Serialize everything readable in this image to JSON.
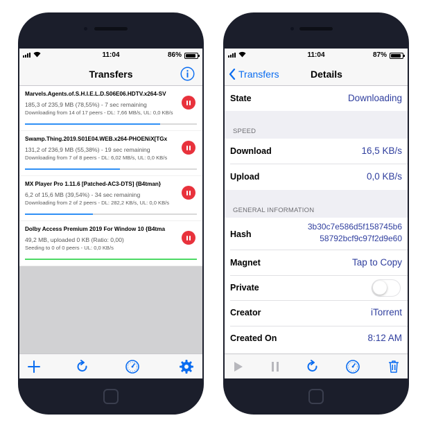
{
  "left_phone": {
    "status": {
      "time": "11:04",
      "battery": "86%",
      "battery_level": 0.86
    },
    "nav": {
      "title": "Transfers"
    },
    "transfers": [
      {
        "name": "Marvels.Agents.of.S.H.I.E.L.D.S06E06.HDTV.x264-SV",
        "size": "185,3 of 235,9 MB (78,55%) - 7 sec remaining",
        "peers": "Downloading from 14 of 17 peers - DL: 7,66 MB/s, UL: 0,0 KB/s",
        "progress": 0.7855,
        "completed": false
      },
      {
        "name": "Swamp.Thing.2019.S01E04.WEB.x264-PHOENiX[TGx",
        "size": "131,2 of 236,9 MB (55,38%) - 19 sec remaining",
        "peers": "Downloading from 7 of 8 peers - DL: 6,02 MB/s, UL: 0,0 KB/s",
        "progress": 0.5538,
        "completed": false
      },
      {
        "name": "MX Player Pro 1.11.6 [Patched-AC3-DTS] {B4tman}",
        "size": "6,2 of 15,6 MB (39,54%) - 34 sec remaining",
        "peers": "Downloading from 2 of 2 peers - DL: 282,2 KB/s, UL: 0,0 KB/s",
        "progress": 0.3954,
        "completed": false
      },
      {
        "name": "Dolby Access Premium 2019 For Window 10 {B4tma",
        "size": "49,2 MB, uploaded 0 KB (Ratio: 0,00)",
        "peers": "Seeding to 0 of 0 peers - UL: 0,0 KB/s",
        "progress": 1.0,
        "completed": true
      }
    ],
    "tabbar": [
      "add-icon",
      "refresh-icon",
      "speedometer-icon",
      "gear-icon"
    ]
  },
  "right_phone": {
    "status": {
      "time": "11:04",
      "battery": "87%",
      "battery_level": 0.87
    },
    "nav": {
      "back_label": "Transfers",
      "title": "Details"
    },
    "state": {
      "label": "State",
      "value": "Downloading"
    },
    "speed_header": "SPEED",
    "download": {
      "label": "Download",
      "value": "16,5 KB/s"
    },
    "upload": {
      "label": "Upload",
      "value": "0,0 KB/s"
    },
    "general_header": "GENERAL INFORMATION",
    "hash": {
      "label": "Hash",
      "line1": "3b30c7e586d5f158745b6",
      "line2": "58792bcf9c97f2d9e60"
    },
    "magnet": {
      "label": "Magnet",
      "value": "Tap to Copy"
    },
    "private": {
      "label": "Private",
      "on": false
    },
    "creator": {
      "label": "Creator",
      "value": "iTorrent"
    },
    "created_on": {
      "label": "Created On",
      "value": "8:12 AM"
    },
    "tabbar": [
      "play-icon",
      "pause-icon",
      "refresh-icon",
      "speedometer-icon",
      "trash-icon"
    ]
  },
  "colors": {
    "accent": "#0a6cf0",
    "value_text": "#2f3e9e",
    "pause_red": "#e8323c",
    "progress_blue": "#2f8ff5",
    "progress_green": "#4cd964"
  }
}
